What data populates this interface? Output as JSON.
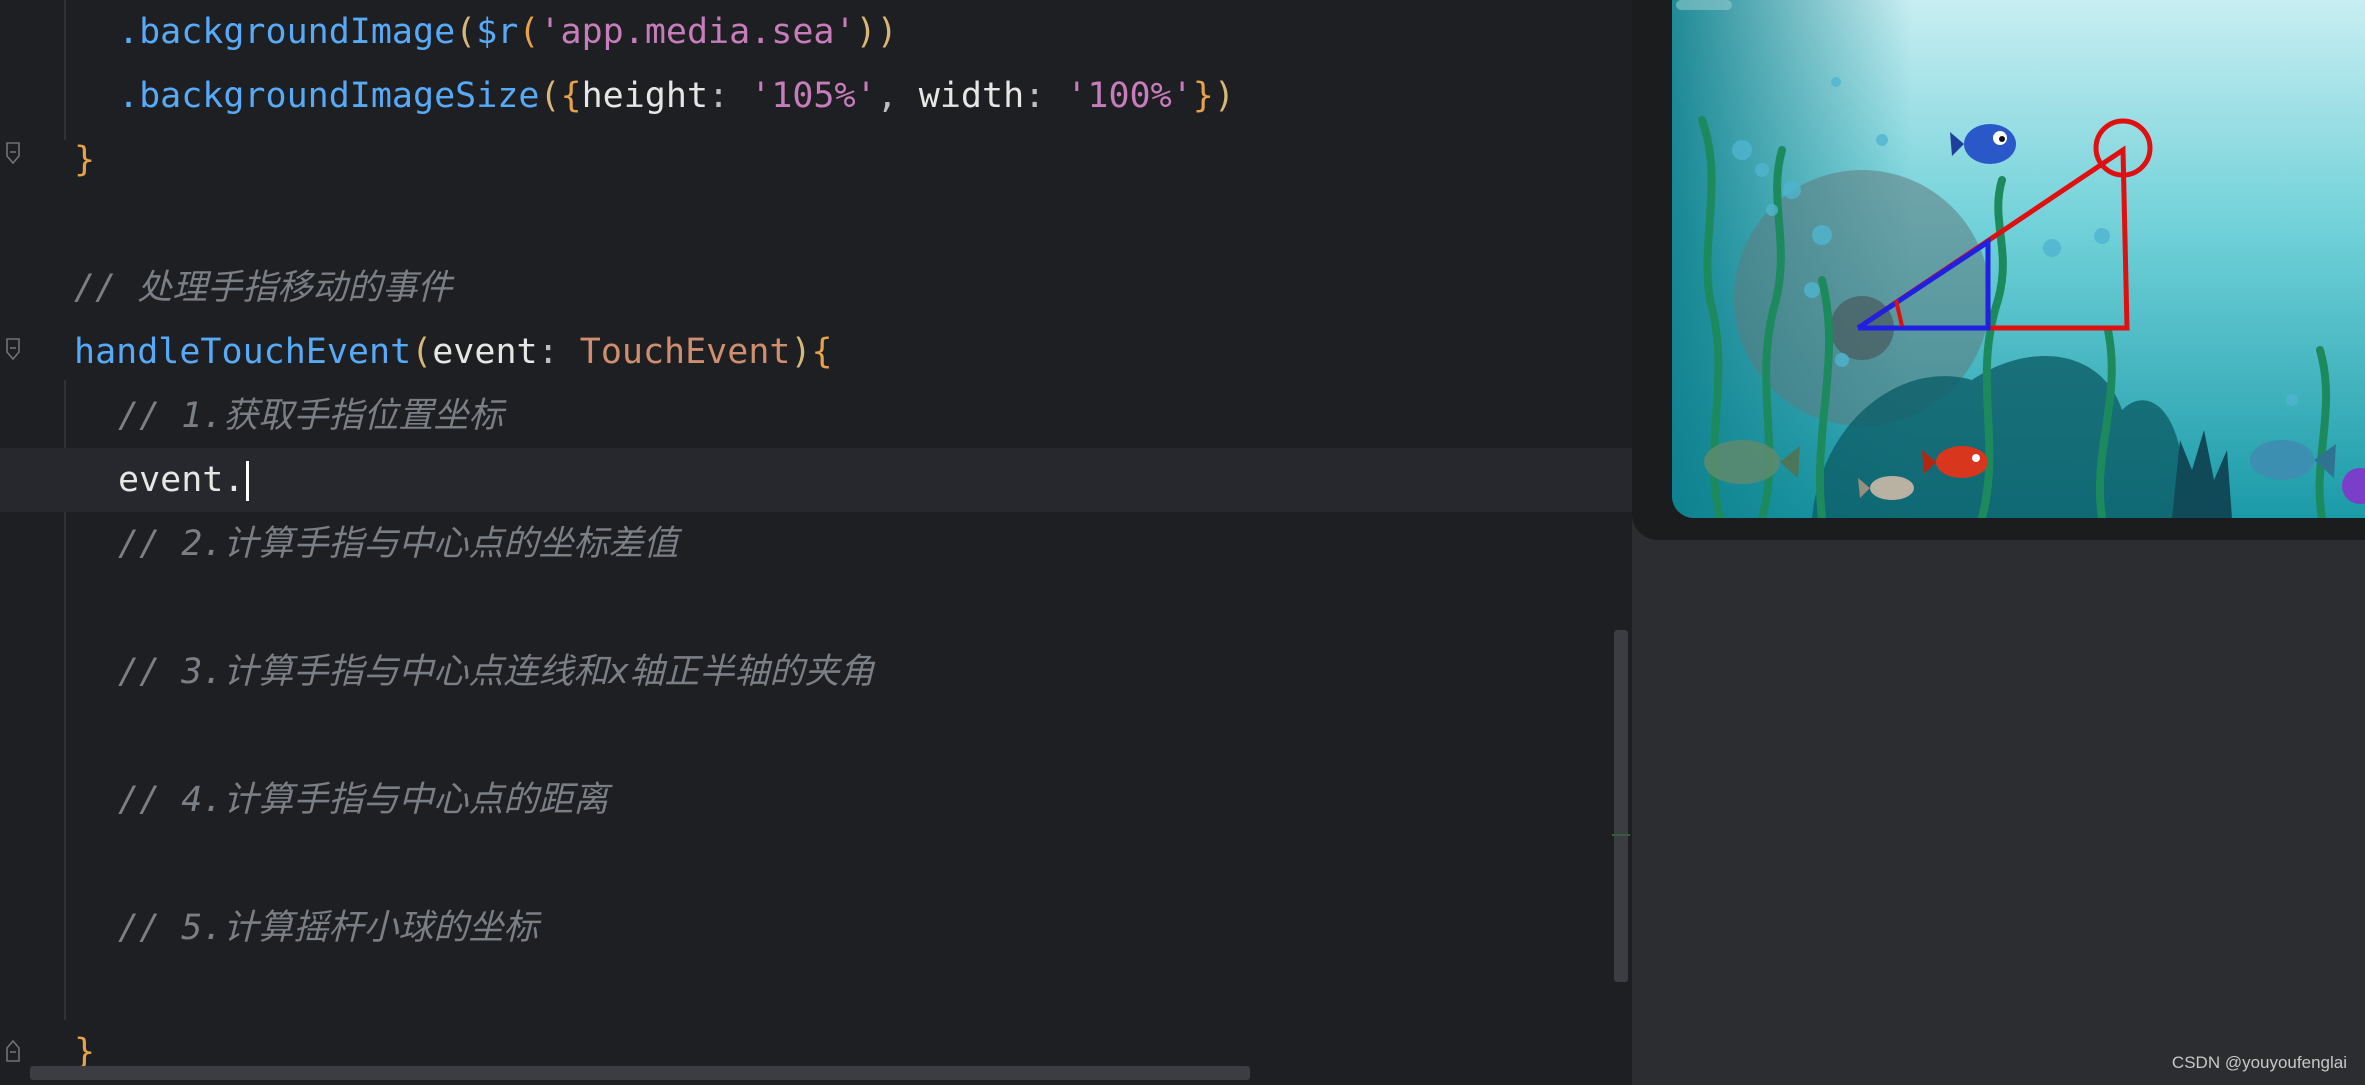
{
  "editor": {
    "lines": {
      "l1": {
        "method": ".backgroundImage",
        "open": "(",
        "res": "$r",
        "ropen": "(",
        "str": "'app.media.sea'",
        "close": "))"
      },
      "l2": {
        "method": ".backgroundImageSize",
        "open": "(",
        "brace": "{",
        "k1": "height",
        "colon1": ": ",
        "v1": "'105%'",
        "comma": ", ",
        "k2": "width",
        "colon2": ": ",
        "v2": "'100%'",
        "brace_close": "}",
        "close": ")"
      },
      "l3": "}",
      "l5": "// 处理手指移动的事件",
      "l6": {
        "name": "handleTouchEvent",
        "open": "(",
        "param": "event",
        "colon": ": ",
        "type": "TouchEvent",
        "close": ")",
        "brace": "{"
      },
      "l7": "// 1.获取手指位置坐标",
      "l8": "event.",
      "l9": "// 2.计算手指与中心点的坐标差值",
      "l11": "// 3.计算手指与中心点连线和x轴正半轴的夹角",
      "l13": "// 4.计算手指与中心点的距离",
      "l15": "// 5.计算摇杆小球的坐标",
      "l17": "}"
    }
  },
  "watermark": "CSDN @youyoufenglai",
  "colors": {
    "editor_bg": "#1e1f22",
    "function": "#57aaf7",
    "string": "#c77dbb",
    "comment": "#7a7e85",
    "type": "#cf8e6d",
    "brace": "#e5a24a",
    "sea_top": "#c8eef2",
    "sea_bottom": "#1b9aa8",
    "triangle_big": "#e01010",
    "triangle_small": "#2020e0"
  }
}
